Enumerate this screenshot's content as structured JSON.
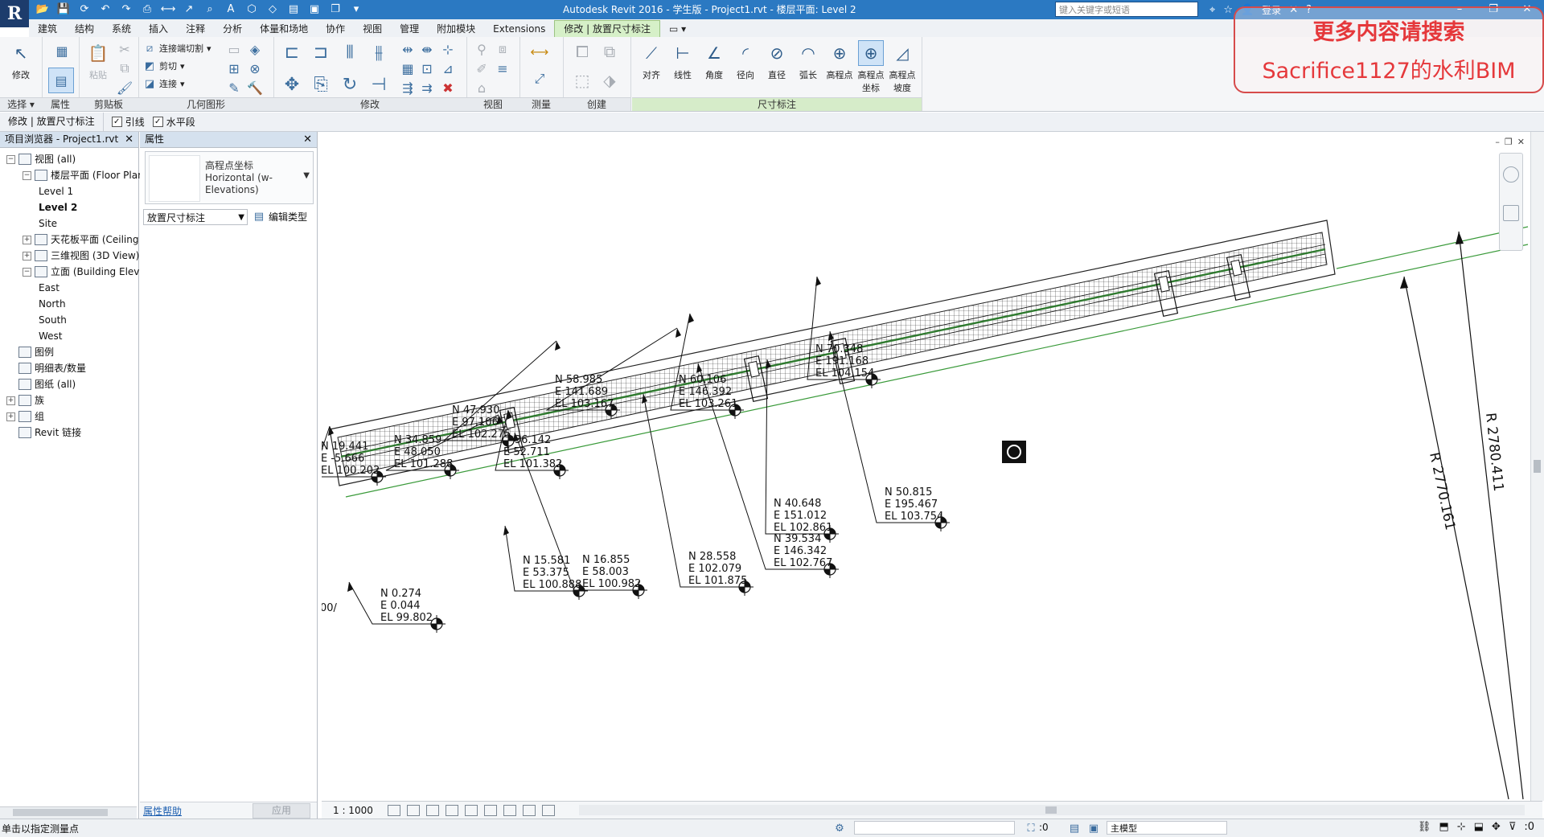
{
  "titlebar": {
    "title": "Autodesk Revit 2016 - 学生版 -      Project1.rvt - 楼层平面: Level 2",
    "search_placeholder": "键入关键字或短语",
    "login": "登录",
    "logo": "R"
  },
  "ribbon_tabs": [
    "建筑",
    "结构",
    "系统",
    "插入",
    "注释",
    "分析",
    "体量和场地",
    "协作",
    "视图",
    "管理",
    "附加模块",
    "Extensions",
    "修改 | 放置尺寸标注"
  ],
  "ribbon_active_tab": 12,
  "ribbon": {
    "panels": {
      "select": "选择",
      "properties": "属性",
      "clipboard": "剪贴板",
      "geometry": "几何图形",
      "modify": "修改",
      "view": "视图",
      "measure": "测量",
      "create": "创建",
      "dimension": "尺寸标注"
    },
    "modify_button": "修改",
    "paste_button": "粘贴",
    "geometry_items": [
      "连接端切割",
      "剪切",
      "连接"
    ],
    "dimension_tools": [
      "对齐",
      "线性",
      "角度",
      "径向",
      "直径",
      "弧长",
      "高程点",
      "高程点坐标",
      "高程点坡度"
    ]
  },
  "promo": {
    "line1": "更多内容请搜索",
    "line2": "Sacrifice1127的水利BIM"
  },
  "options_bar": {
    "context": "修改 | 放置尺寸标注",
    "leader_label": "引线",
    "shoulder_label": "水平段",
    "leader_checked": true,
    "shoulder_checked": true
  },
  "project_browser": {
    "title": "项目浏览器 - Project1.rvt",
    "items": [
      {
        "label": "视图 (all)",
        "level": 0,
        "toggle": "−"
      },
      {
        "label": "楼层平面 (Floor Plan",
        "level": 1,
        "toggle": "−"
      },
      {
        "label": "Level 1",
        "level": 2
      },
      {
        "label": "Level 2",
        "level": 2,
        "bold": true
      },
      {
        "label": "Site",
        "level": 2
      },
      {
        "label": "天花板平面 (Ceiling Pl",
        "level": 1,
        "toggle": "+"
      },
      {
        "label": "三维视图 (3D View)",
        "level": 1,
        "toggle": "+"
      },
      {
        "label": "立面 (Building Elevati",
        "level": 1,
        "toggle": "−"
      },
      {
        "label": "East",
        "level": 2
      },
      {
        "label": "North",
        "level": 2
      },
      {
        "label": "South",
        "level": 2
      },
      {
        "label": "West",
        "level": 2
      },
      {
        "label": "图例",
        "level": 0
      },
      {
        "label": "明细表/数量",
        "level": 0
      },
      {
        "label": "图纸 (all)",
        "level": 0
      },
      {
        "label": "族",
        "level": 0,
        "toggle": "+"
      },
      {
        "label": "组",
        "level": 0,
        "toggle": "+"
      },
      {
        "label": "Revit 链接",
        "level": 0
      }
    ]
  },
  "properties": {
    "title": "属性",
    "type_name": "高程点坐标",
    "type_sub": "Horizontal (w-Elevations)",
    "instance_filter": "放置尺寸标注",
    "edit_type": "编辑类型",
    "help_link": "属性帮助",
    "apply": "应用"
  },
  "drawing": {
    "radius_labels": [
      "R 2770.161",
      "R 2780.411"
    ],
    "spot_coordinates": [
      {
        "n": "N 0.274",
        "e": "E 0.044",
        "el": "EL 99.802"
      },
      {
        "n": "N 19.441",
        "e": "E -5.666",
        "el": "EL 100.202"
      },
      {
        "n": "N 15.581",
        "e": "E 53.375",
        "el": "EL 100.888"
      },
      {
        "n": "N 34.859",
        "e": "E 48.050",
        "el": "EL 101.288"
      },
      {
        "n": "N 36.142",
        "e": "E 52.711",
        "el": "EL 101.382"
      },
      {
        "n": "N 16.855",
        "e": "E 58.003",
        "el": "EL 100.982"
      },
      {
        "n": "N 47.930",
        "e": "E 97.106",
        "el": "EL 102.275"
      },
      {
        "n": "N 28.558",
        "e": "E 102.079",
        "el": "EL 101.875"
      },
      {
        "n": "N 58.985",
        "e": "E 141.689",
        "el": "EL 103.167"
      },
      {
        "n": "N 60.106",
        "e": "E 146.392",
        "el": "EL 103.261"
      },
      {
        "n": "N 39.534",
        "e": "E 146.342",
        "el": "EL 102.767"
      },
      {
        "n": "N 40.648",
        "e": "E 151.012",
        "el": "EL 102.861"
      },
      {
        "n": "N 70.348",
        "e": "E 191.168",
        "el": "EL 104.154"
      },
      {
        "n": "N 50.815",
        "e": "E 195.467",
        "el": "EL 103.754"
      }
    ],
    "partial_label": "00/"
  },
  "view_bar": {
    "scale": "1 : 1000"
  },
  "status_bar": {
    "message": "单击以指定测量点",
    "coord_value": ":0",
    "model_combo": "主模型",
    "filter_value": ":0"
  },
  "colors": {
    "titlebar": "#2b79c2",
    "context_tab": "#d6f0c8",
    "promo": "#e5383b",
    "alignment_green": "#3a9a3a"
  }
}
